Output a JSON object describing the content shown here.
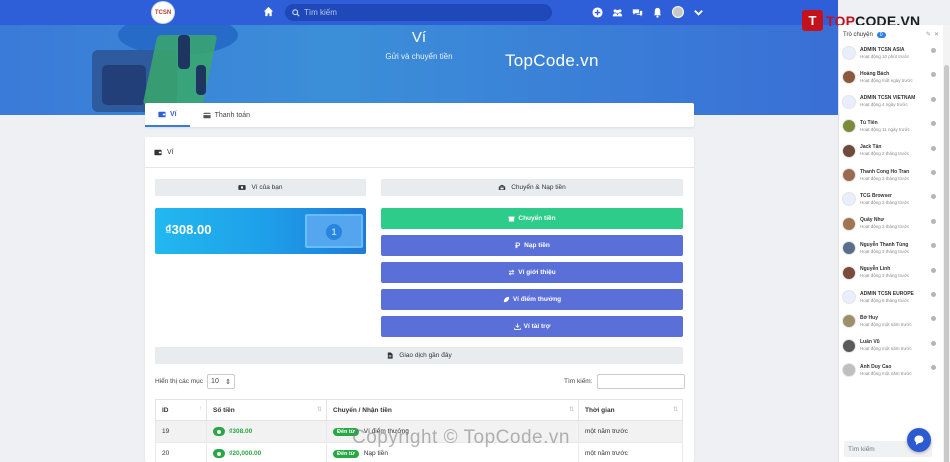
{
  "topnav": {
    "logo_text": "TCSN",
    "search_placeholder": "Tìm kiếm"
  },
  "banner": {
    "title": "Ví",
    "subtitle": "Gửi và chuyển tiền"
  },
  "tabs": [
    {
      "label": "Ví",
      "active": true
    },
    {
      "label": "Thanh toán",
      "active": false
    }
  ],
  "card": {
    "header": "Ví",
    "wallet_section": "Ví của bạn",
    "transfer_section": "Chuyển & Nạp tiền",
    "balance": "₫308.00",
    "actions": [
      "Chuyển tiền",
      "Nạp tiền",
      "Ví giới thiệu",
      "Ví điểm thưởng",
      "Ví tài trợ"
    ],
    "action_colors": [
      "#2ecc8a",
      "#5b6fd8",
      "#5b6fd8",
      "#5b6fd8",
      "#5b6fd8"
    ],
    "recent_section": "Giao dịch gần đây"
  },
  "table_controls": {
    "show_label": "Hiển thị các mục",
    "page_size": "10",
    "search_label": "Tìm kiếm:"
  },
  "table": {
    "headers": [
      "ID",
      "Số tiền",
      "Chuyển / Nhận tiền",
      "Thời gian"
    ],
    "rows": [
      {
        "id": "19",
        "amount": "₫308.00",
        "badge": "Đến từ",
        "detail": "Ví điểm thưởng",
        "time": "một năm trước"
      },
      {
        "id": "20",
        "amount": "₫20,000.00",
        "badge": "Đến từ",
        "detail": "Nạp tiền",
        "time": "một năm trước"
      }
    ]
  },
  "watermarks": {
    "center": "TopCode.vn",
    "bottom": "Copyright © TopCode.vn",
    "brand_prefix": "TOP",
    "brand_suffix": "CODE.VN",
    "brand_mark": "T"
  },
  "sidebar": {
    "title": "Trò chuyện",
    "count": "0",
    "contacts": [
      {
        "name": "ADMIN TCSN ASIA",
        "status": "Hoạt động 10 phút trước"
      },
      {
        "name": "Hoàng Bách",
        "status": "Hoạt động một ngày trước"
      },
      {
        "name": "ADMIN TCSN VIETNAM",
        "status": "Hoạt động 4 ngày trước"
      },
      {
        "name": "Tú Tiên",
        "status": "Hoạt động 11 ngày trước"
      },
      {
        "name": "Jack Tân",
        "status": "Hoạt động 2 tháng trước"
      },
      {
        "name": "Thanh Cong Ho Tran",
        "status": "Hoạt động 2 tháng trước"
      },
      {
        "name": "TCG Browser",
        "status": "Hoạt động 2 tháng trước"
      },
      {
        "name": "Quây Như",
        "status": "Hoạt động 2 tháng trước"
      },
      {
        "name": "Nguyễn Thanh Tùng",
        "status": "Hoạt động 3 tháng trước"
      },
      {
        "name": "Nguyễn Linh",
        "status": "Hoạt động 3 tháng trước"
      },
      {
        "name": "ADMIN TCSN EUROPE",
        "status": "Hoạt động 6 tháng trước"
      },
      {
        "name": "Bờ Huy",
        "status": "Hoạt động một năm trước"
      },
      {
        "name": "Luân Vũ",
        "status": "Hoạt động một năm trước"
      },
      {
        "name": "Anh Duy Cao",
        "status": "Hoạt động một năm trước"
      }
    ],
    "search_placeholder": "Tìm kiếm"
  }
}
